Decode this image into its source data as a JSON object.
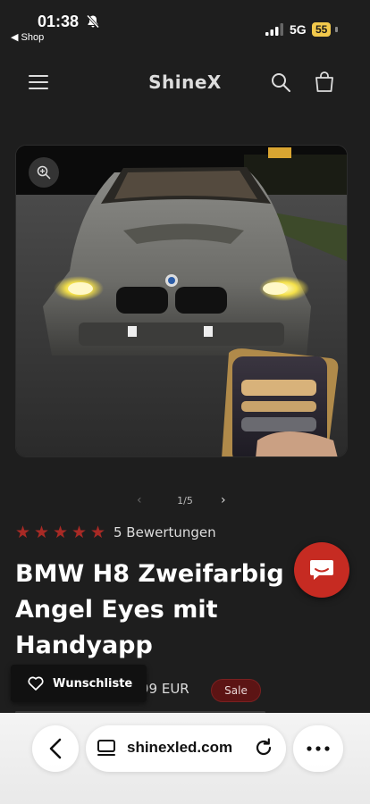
{
  "status_bar": {
    "time": "01:38",
    "back_app": "◀ Shop",
    "network": "5G",
    "battery": "55"
  },
  "header": {
    "brand": "ShineX"
  },
  "gallery": {
    "counter": "1/5",
    "prev": "‹",
    "next": "›"
  },
  "rating": {
    "stars": 5,
    "text": "5 Bewertungen"
  },
  "product": {
    "title": "BMW H8 Zweifarbig Angel Eyes mit Handyapp",
    "price": "99 EUR",
    "sale_badge": "Sale"
  },
  "wishlist": {
    "label": "Wunschliste"
  },
  "browser": {
    "url": "shinexled.com"
  },
  "colors": {
    "background": "#1e1e1e",
    "star": "#a82a25",
    "chat_button": "#c62b22",
    "sale_badge": "#5c1414",
    "battery": "#f2c94c"
  }
}
